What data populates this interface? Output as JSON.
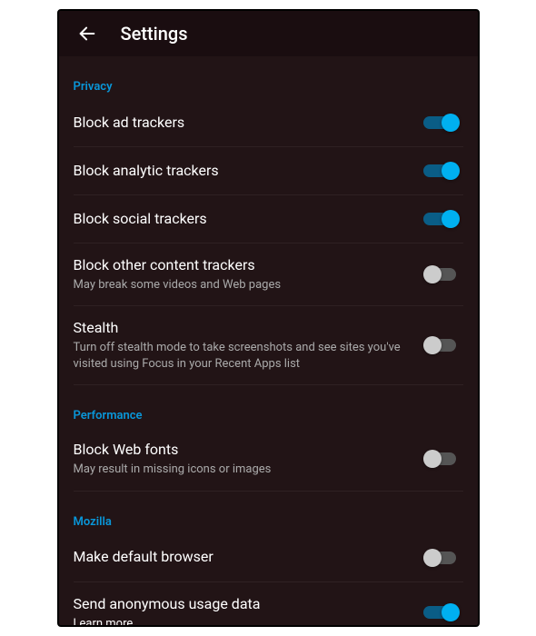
{
  "header": {
    "title": "Settings"
  },
  "sections": {
    "privacy": {
      "label": "Privacy",
      "items": {
        "blockAdTrackers": {
          "title": "Block ad trackers",
          "sub": "",
          "on": true
        },
        "blockAnalyticTrackers": {
          "title": "Block analytic trackers",
          "sub": "",
          "on": true
        },
        "blockSocialTrackers": {
          "title": "Block social trackers",
          "sub": "",
          "on": true
        },
        "blockOtherContentTrackers": {
          "title": "Block other content trackers",
          "sub": "May break some videos and Web pages",
          "on": false
        },
        "stealth": {
          "title": "Stealth",
          "sub": "Turn off stealth mode to take screenshots and see sites you've visited using Focus in your Recent Apps list",
          "on": false
        }
      }
    },
    "performance": {
      "label": "Performance",
      "items": {
        "blockWebFonts": {
          "title": "Block Web fonts",
          "sub": "May result in missing icons or images",
          "on": false
        }
      }
    },
    "mozilla": {
      "label": "Mozilla",
      "items": {
        "makeDefaultBrowser": {
          "title": "Make default browser",
          "sub": "",
          "on": false
        },
        "sendAnonymousUsageData": {
          "title": "Send anonymous usage data",
          "sub": "",
          "learnMore": "Learn more",
          "on": true
        }
      }
    }
  }
}
